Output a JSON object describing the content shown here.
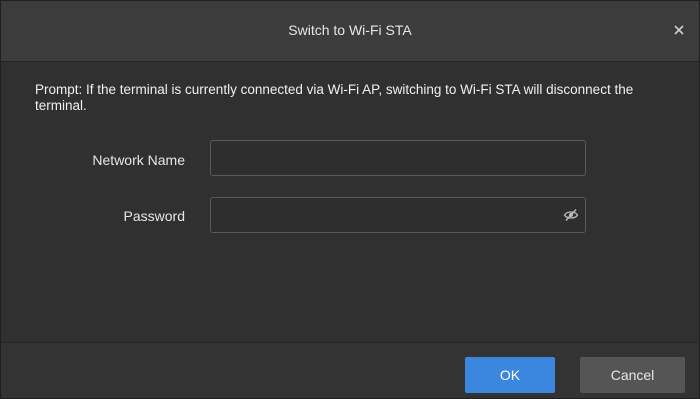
{
  "dialog": {
    "title": "Switch to Wi-Fi STA",
    "close_icon": "close-icon"
  },
  "prompt": {
    "text": "Prompt: If the terminal is currently connected via Wi-Fi AP, switching to Wi-Fi STA will disconnect the terminal."
  },
  "form": {
    "network_name_label": "Network Name",
    "network_name_value": "",
    "password_label": "Password",
    "password_value": "",
    "password_toggle_icon": "eye-slash-icon"
  },
  "footer": {
    "ok_label": "OK",
    "cancel_label": "Cancel"
  },
  "colors": {
    "background": "#303030",
    "titlebar": "#3c3c3c",
    "primary_button": "#3b87e0",
    "secondary_button": "#555555",
    "text": "#e6e6e6"
  }
}
